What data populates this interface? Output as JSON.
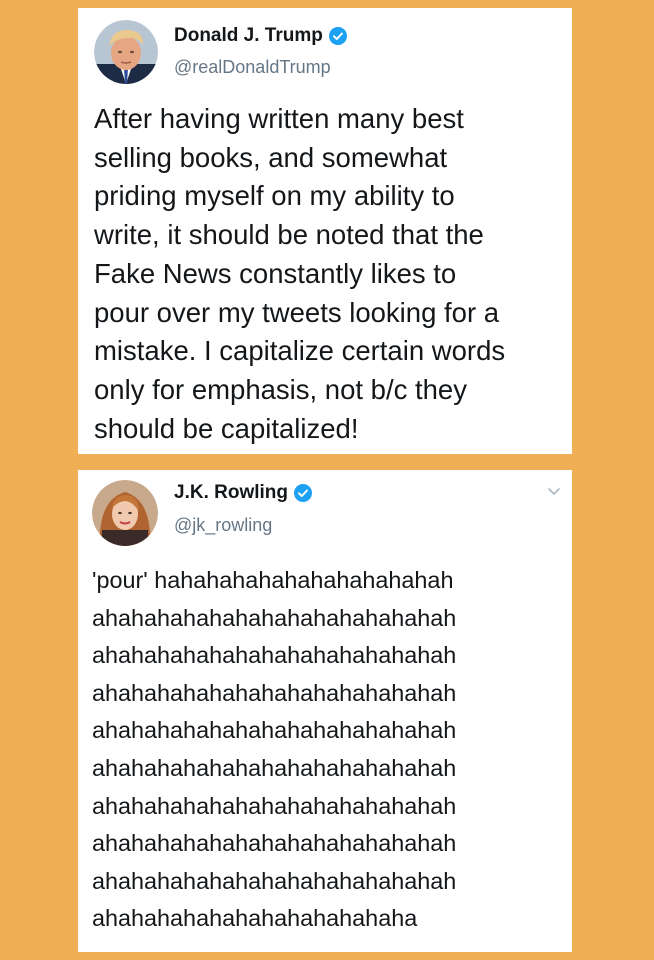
{
  "colors": {
    "background": "#F0AE55",
    "card": "#FFFFFF",
    "text": "#14171A",
    "handle": "#657786",
    "verified_badge": "#1DA1F2"
  },
  "tweets": [
    {
      "display_name": "Donald J. Trump",
      "handle": "@realDonaldTrump",
      "verified": true,
      "avatar_icon": "profile-photo-trump",
      "text": "After having written many best\nselling books, and somewhat\npriding myself on my ability to\nwrite, it should be noted that the\nFake News constantly likes to\npour over my tweets looking for a\nmistake. I capitalize certain words\nonly for emphasis, not b/c they\nshould be capitalized!"
    },
    {
      "display_name": "J.K. Rowling",
      "handle": "@jk_rowling",
      "verified": true,
      "avatar_icon": "profile-photo-rowling",
      "menu_icon": "chevron-down-icon",
      "text": "'pour' hahahahahahahahahahahah\nahahahahahahahahahahahahahah\nahahahahahahahahahahahahahah\nahahahahahahahahahahahahahah\nahahahahahahahahahahahahahah\nahahahahahahahahahahahahahah\nahahahahahahahahahahahahahah\nahahahahahahahahahahahahahah\nahahahahahahahahahahahahahah\nahahahahahahahahahahahaha"
    }
  ]
}
